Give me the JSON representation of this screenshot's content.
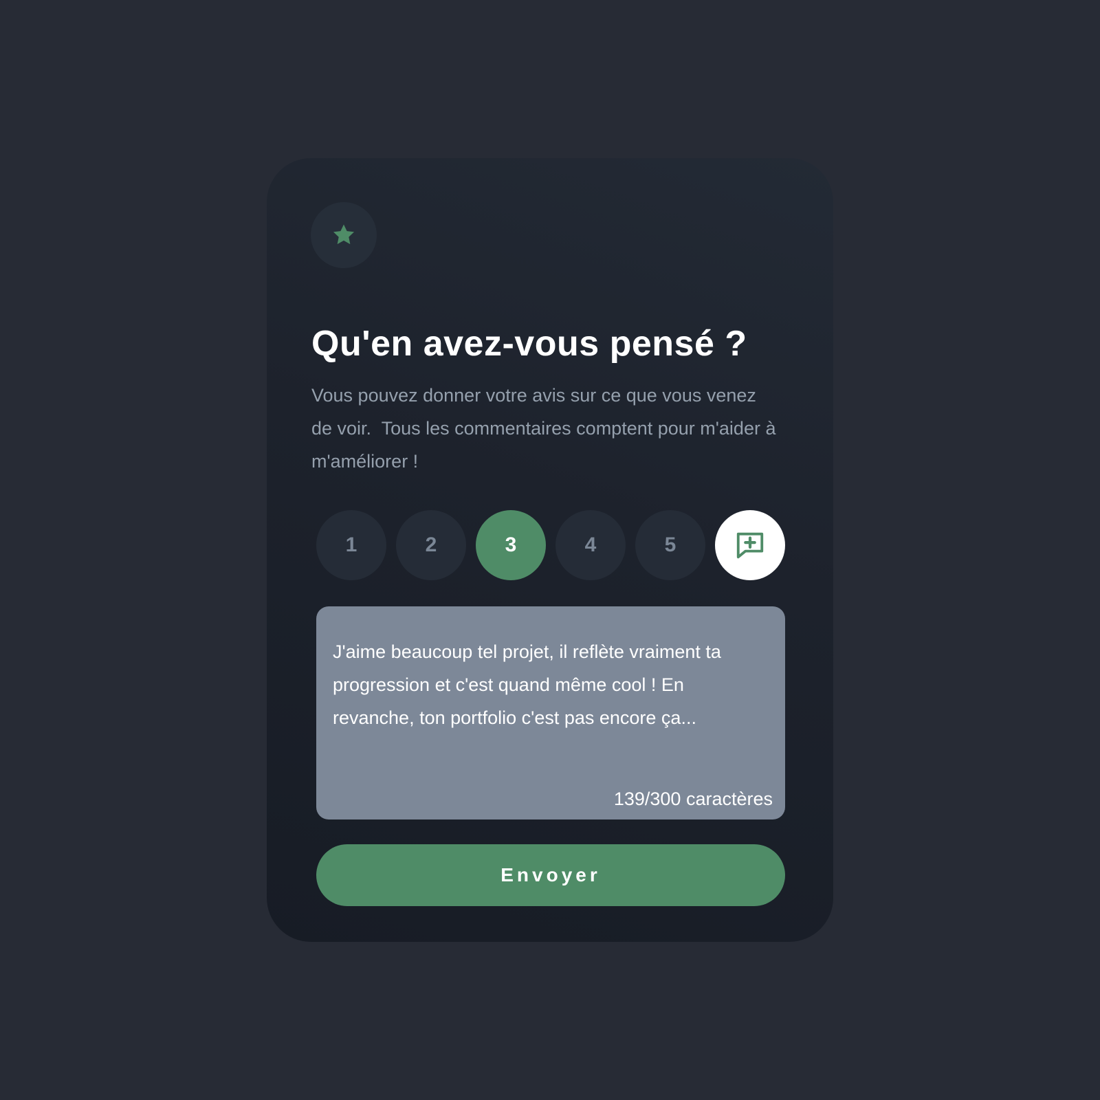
{
  "card": {
    "title": "Qu'en avez-vous pensé ?",
    "description": "Vous pouvez donner votre avis sur ce que vous venez de voir.  Tous les commentaires comptent pour m'aider à m'améliorer !"
  },
  "icons": {
    "badge": "star-icon",
    "comment_toggle": "comment-add-icon"
  },
  "rating": {
    "options": [
      "1",
      "2",
      "3",
      "4",
      "5"
    ],
    "selected": "3"
  },
  "comment": {
    "text": "J'aime beaucoup tel projet, il reflète vraiment ta progression et c'est quand même cool ! En revanche, ton portfolio c'est pas encore ça...",
    "char_count": "139/300 caractères"
  },
  "submit": {
    "label": "Envoyer"
  },
  "colors": {
    "page_background": "#272b35",
    "accent": "#4f8c67",
    "text_primary": "#ffffff",
    "text_muted": "#95a0ad",
    "textarea_background": "#7d8898"
  }
}
